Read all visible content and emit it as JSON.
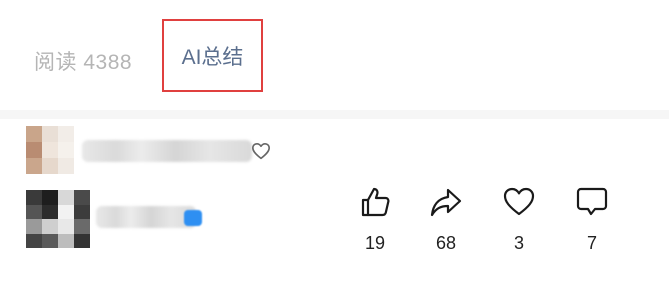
{
  "meta": {
    "read_label": "阅读 4388",
    "ai_summary_label": "AI总结"
  },
  "actions": {
    "like_count": "19",
    "share_count": "68",
    "favorite_count": "3",
    "comment_count": "7"
  },
  "icons": {
    "like": "thumbs-up-icon",
    "share": "share-arrow-icon",
    "favorite": "heart-icon",
    "comment": "comment-bubble-icon",
    "liked_by": "heart-outline-icon"
  },
  "colors": {
    "highlight_border": "#e0403f",
    "ai_text": "#5b6f8e",
    "muted_text": "#b5b5b5",
    "verified_badge": "#2e8ff2"
  }
}
